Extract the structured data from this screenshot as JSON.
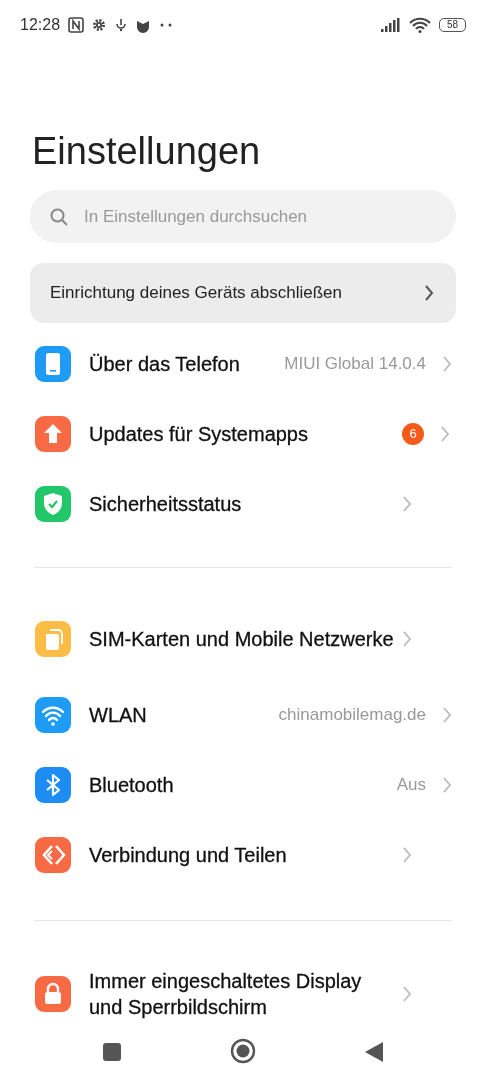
{
  "status_bar": {
    "time": "12:28",
    "battery": "58"
  },
  "title": "Einstellungen",
  "search": {
    "placeholder": "In Einstellungen durchsuchen"
  },
  "setup_banner": {
    "label": "Einrichtung deines Geräts abschließen"
  },
  "sections": [
    {
      "items": [
        {
          "kind": "phone",
          "color": "#1e9bf5",
          "title": "Über das Telefon",
          "value": "MIUI Global 14.0.4"
        },
        {
          "kind": "update",
          "color": "#f86a43",
          "title": "Updates für Systemapps",
          "badge": "6"
        },
        {
          "kind": "shield",
          "color": "#22c76a",
          "title": "Sicherheitsstatus"
        }
      ]
    },
    {
      "items": [
        {
          "kind": "sim",
          "color": "#fbbd46",
          "title": "SIM-Karten und Mobile Netzwerke"
        },
        {
          "kind": "wifi",
          "color": "#1e9bf5",
          "title": "WLAN",
          "value": "chinamobilemag.de"
        },
        {
          "kind": "bluetooth",
          "color": "#1e8cf5",
          "title": "Bluetooth",
          "value": "Aus"
        },
        {
          "kind": "share",
          "color": "#f86a43",
          "title": "Verbindung und Teilen"
        }
      ]
    },
    {
      "items": [
        {
          "kind": "lock",
          "color": "#f86a43",
          "title": "Immer eingeschaltetes Display und Sperrbildschirm"
        }
      ]
    }
  ]
}
